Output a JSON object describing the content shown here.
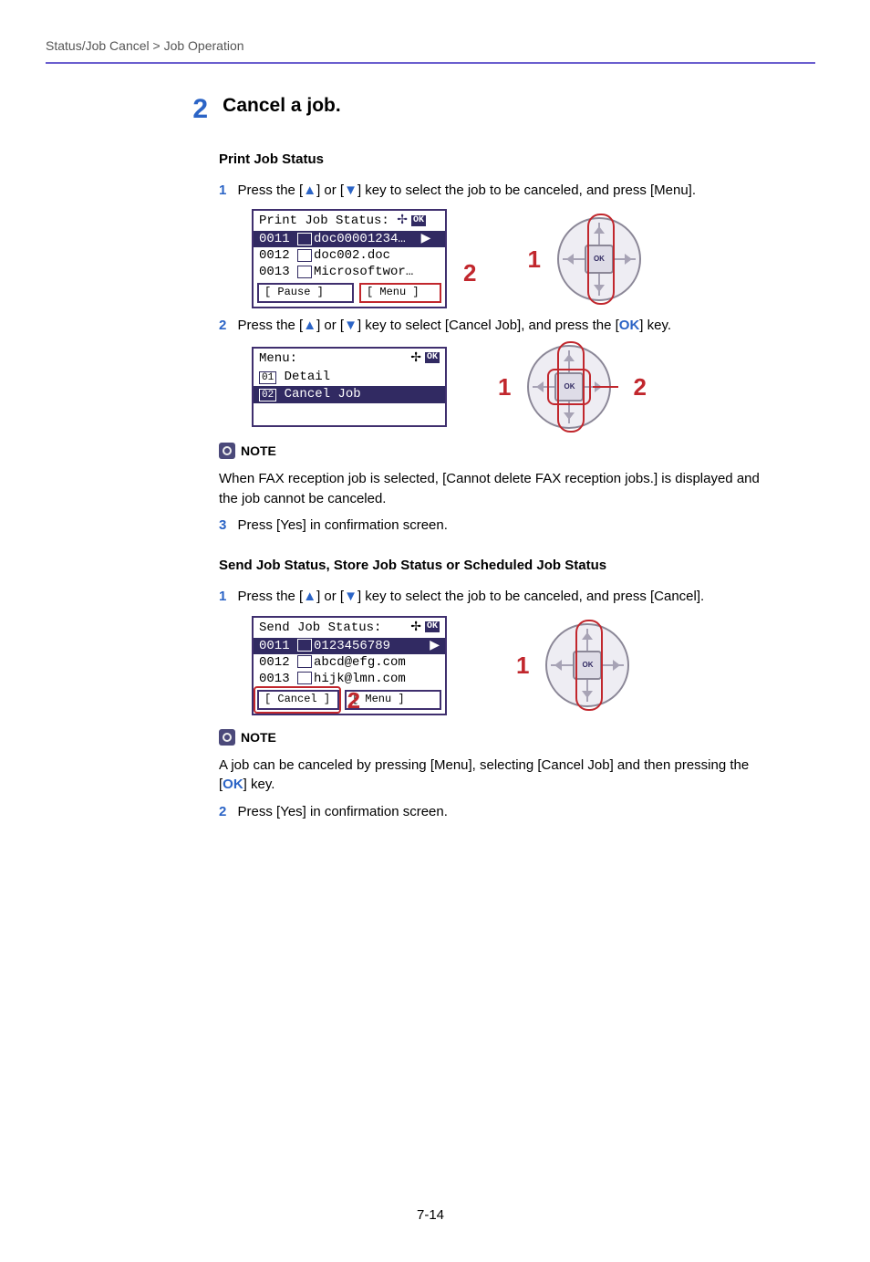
{
  "breadcrumb": "Status/Job Cancel > Job Operation",
  "page_footer": "7-14",
  "step": {
    "num": "2",
    "title": "Cancel a job."
  },
  "print": {
    "heading": "Print Job Status",
    "line1_pre": "Press the [",
    "line1_mid": "] or [",
    "line1_post": "] key to select the job to be canceled, and press [Menu].",
    "lcd": {
      "title": "Print Job Status:",
      "row1_id": "0011",
      "row1_label": "doc00001234…",
      "row2_id": "0012",
      "row2_label": "doc002.doc",
      "row3_id": "0013",
      "row3_label": "Microsoftwor…",
      "btn_left": "Pause",
      "btn_right": "Menu"
    },
    "line2_pre": "Press the [",
    "line2_mid": "] or [",
    "line2_post1": "] key to select [Cancel Job], and press the [",
    "line2_ok": "OK",
    "line2_post2": "] key.",
    "menu_lcd": {
      "title": "Menu:",
      "row1_num": "01",
      "row1": "Detail",
      "row2_num": "02",
      "row2": "Cancel Job"
    },
    "note_label": "NOTE",
    "note_body": "When FAX reception job is selected, [Cannot delete FAX reception jobs.] is displayed and the job cannot be canceled.",
    "line3": "Press [Yes] in confirmation screen."
  },
  "send": {
    "heading": "Send Job Status, Store Job Status or Scheduled Job Status",
    "line1_pre": "Press the [",
    "line1_mid": "] or [",
    "line1_post": "] key to select the job to be canceled, and press [Cancel].",
    "lcd": {
      "title": "Send Job Status:",
      "row1_id": "0011",
      "row1_label": "0123456789",
      "row2_id": "0012",
      "row2_label": "abcd@efg.com",
      "row3_id": "0013",
      "row3_label": "hijk@lmn.com",
      "btn_left": "Cancel",
      "btn_right": "Menu"
    },
    "note_label": "NOTE",
    "note_body_a": "A job can be canceled by pressing [Menu], selecting [Cancel Job] and then pressing the [",
    "note_ok": "OK",
    "note_body_b": "] key.",
    "line2": "Press [Yes] in confirmation screen."
  }
}
